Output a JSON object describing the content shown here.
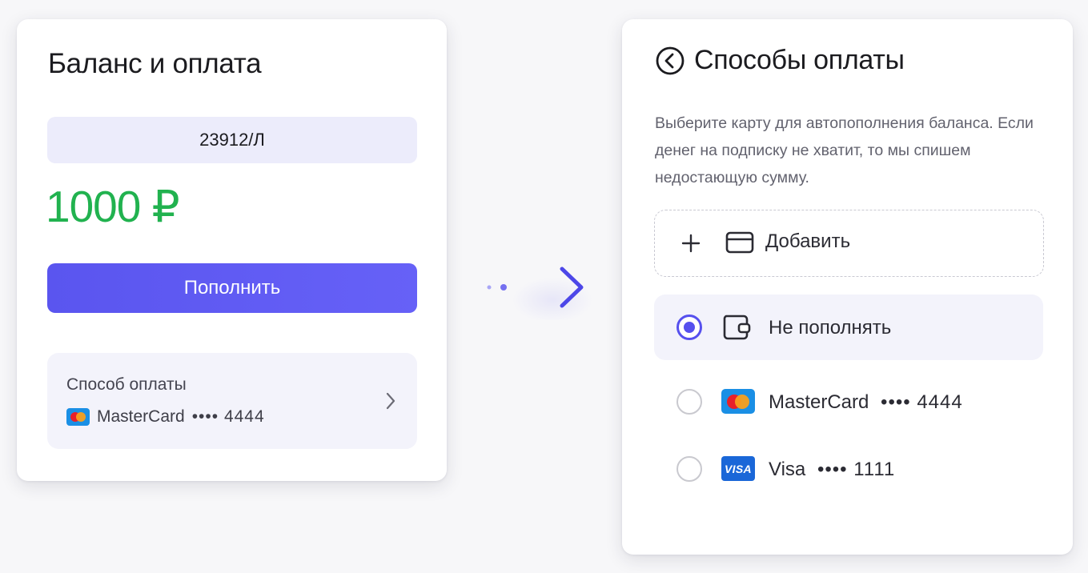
{
  "left_panel": {
    "title": "Баланс и оплата",
    "account_number": "23912/Л",
    "balance": "1000 ₽",
    "topup_button": "Пополнить",
    "payment_method": {
      "label": "Способ оплаты",
      "card_brand": "MasterCard",
      "card_mask": "•••• 4444",
      "icon": "chevron-right-icon"
    }
  },
  "right_panel": {
    "title": "Способы оплаты",
    "back_icon": "back-arrow-icon",
    "description": "Выберите карту для автопополнения баланса. Если денег на подписку не хватит, то мы спишем недостающую сумму.",
    "add_label": "Добавить",
    "options": [
      {
        "label": "Не пополнять",
        "selected": true,
        "icon": "wallet-icon"
      },
      {
        "brand": "MasterCard",
        "mask": "•••• 4444",
        "selected": false,
        "icon": "mastercard-logo"
      },
      {
        "brand": "Visa",
        "mask": "•••• 1111",
        "selected": false,
        "icon": "visa-logo",
        "logo_text": "VISA"
      }
    ]
  },
  "colors": {
    "accent": "#5650ee",
    "balance": "#21b24f",
    "background": "#f7f7f9"
  }
}
